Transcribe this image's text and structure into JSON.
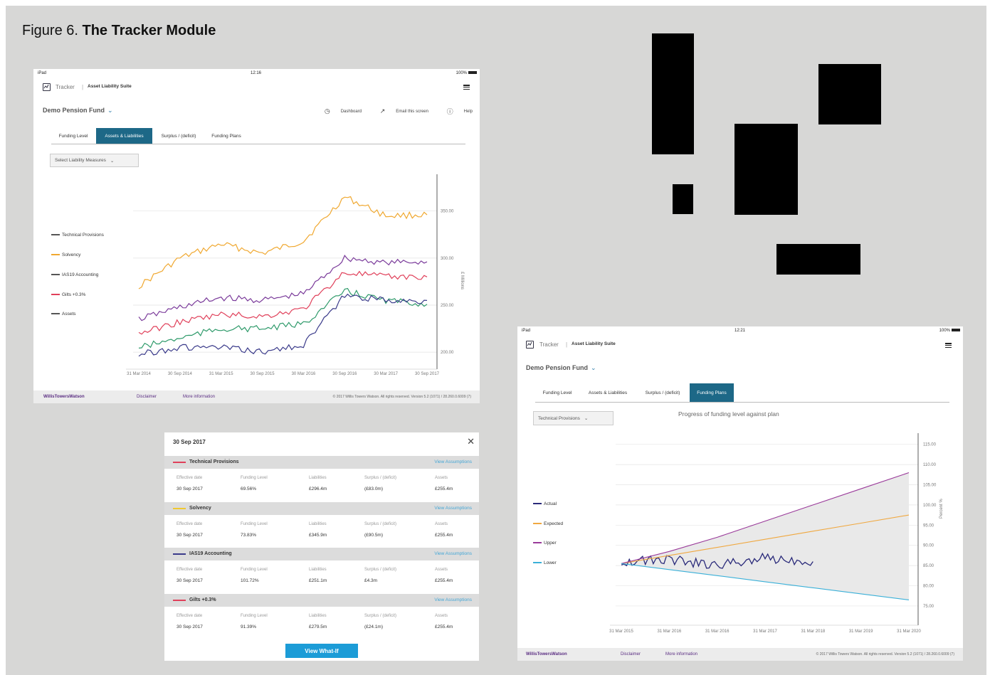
{
  "figure": {
    "label": "Figure 6.",
    "title": "The Tracker Module"
  },
  "screen1": {
    "status": {
      "carrier": "iPad",
      "time": "12:16",
      "battery": "100%"
    },
    "app": {
      "name": "Tracker",
      "suite": "Asset Liability Suite"
    },
    "fund": "Demo Pension Fund",
    "actions": {
      "dashboard": "Dashboard",
      "email": "Email this screen",
      "help": "Help"
    },
    "tabs": [
      "Funding Level",
      "Assets & Liabilities",
      "Surplus / (deficit)",
      "Funding Plans"
    ],
    "active_tab": "Assets & Liabilities",
    "select": "Select Liability Measures",
    "legend": [
      "Technical Provisions",
      "Solvency",
      "IAS19 Accounting",
      "Gilts +0.3%",
      "Assets"
    ],
    "colors": {
      "technical_provisions": "#7a3a9a",
      "solvency": "#f0a830",
      "ias19": "#2e9a6a",
      "gilts": "#e0405a",
      "assets": "#3a3a8a"
    },
    "y_axis_label": "£ Millions",
    "y_ticks": [
      "350.00",
      "300.00",
      "250.00",
      "200.00"
    ],
    "x_ticks": [
      "31 Mar 2014",
      "30 Sep 2014",
      "31 Mar 2015",
      "30 Sep 2015",
      "30 Mar 2016",
      "30 Sep 2016",
      "30 Mar 2017",
      "30 Sep 2017"
    ],
    "footer": {
      "brand": "WillisTowersWatson",
      "disclaimer": "Disclaimer",
      "more": "More information",
      "copyright": "© 2017 Willis Towers Watson. All rights reserved. Version 5.2 (1071) / 28.260.0.6009 (7)"
    }
  },
  "popup": {
    "date": "30 Sep 2017",
    "view_assumptions": "View Assumptions",
    "headers": [
      "Effective date",
      "Funding Level",
      "Liabilities",
      "Surplus / (deficit)",
      "Assets"
    ],
    "sections": [
      {
        "name": "Technical Provisions",
        "color": "#e0405a",
        "values": [
          "30 Sep 2017",
          "69.56%",
          "£296.4m",
          "(£83.0m)",
          "£255.4m"
        ]
      },
      {
        "name": "Solvency",
        "color": "#f0c830",
        "values": [
          "30 Sep 2017",
          "73.83%",
          "£345.9m",
          "(£90.5m)",
          "£255.4m"
        ]
      },
      {
        "name": "IAS19 Accounting",
        "color": "#3a3a8a",
        "values": [
          "30 Sep 2017",
          "101.72%",
          "£251.1m",
          "£4.3m",
          "£255.4m"
        ]
      },
      {
        "name": "Gilts +0.3%",
        "color": "#e0405a",
        "values": [
          "30 Sep 2017",
          "91.39%",
          "£279.5m",
          "(£24.1m)",
          "£255.4m"
        ]
      }
    ],
    "button": "View What-If"
  },
  "screen2": {
    "status": {
      "carrier": "iPad",
      "time": "12:21",
      "battery": "100%"
    },
    "app": {
      "name": "Tracker",
      "suite": "Asset Liability Suite"
    },
    "fund": "Demo Pension Fund",
    "tabs": [
      "Funding Level",
      "Assets & Liabilities",
      "Surplus / (deficit)",
      "Funding Plans"
    ],
    "active_tab": "Funding Plans",
    "select": "Technical Provisions",
    "chart_title": "Progress of funding level against plan",
    "legend": [
      "Actual",
      "Expected",
      "Upper",
      "Lower"
    ],
    "colors": {
      "actual": "#2a2a7a",
      "expected": "#f0a840",
      "upper": "#9a3a9a",
      "lower": "#3ab0d8"
    },
    "y_axis_label": "Percent %",
    "y_ticks": [
      "115.00",
      "110.00",
      "105.00",
      "100.00",
      "95.00",
      "90.00",
      "85.00",
      "80.00",
      "75.00"
    ],
    "x_ticks": [
      "31 Mar 2015",
      "31 Mar 2016",
      "31 Mar 2016",
      "31 Mar 2017",
      "31 Mar 2018",
      "31 Mar 2019",
      "31 Mar 2020"
    ],
    "footer": {
      "brand": "WillisTowersWatson",
      "disclaimer": "Disclaimer",
      "more": "More information",
      "copyright": "© 2017 Willis Towers Watson. All rights reserved. Version 5.2 (1071) / 28.260.0.6009 (7)"
    }
  },
  "chart_data": [
    {
      "type": "line",
      "x": [
        "31 Mar 2014",
        "30 Sep 2014",
        "31 Mar 2015",
        "30 Sep 2015",
        "30 Mar 2016",
        "30 Sep 2016",
        "30 Mar 2017",
        "30 Sep 2017"
      ],
      "ylabel": "£ Millions",
      "ylim": [
        185,
        380
      ],
      "series": [
        {
          "name": "Solvency",
          "values": [
            270,
            300,
            315,
            305,
            318,
            365,
            345,
            346
          ]
        },
        {
          "name": "Technical Provisions",
          "values": [
            235,
            248,
            258,
            255,
            262,
            300,
            295,
            296
          ]
        },
        {
          "name": "Gilts +0.3%",
          "values": [
            220,
            232,
            240,
            238,
            246,
            285,
            280,
            280
          ]
        },
        {
          "name": "IAS19 Accounting",
          "values": [
            205,
            215,
            225,
            225,
            230,
            265,
            255,
            251
          ]
        },
        {
          "name": "Assets",
          "values": [
            198,
            205,
            205,
            200,
            208,
            260,
            255,
            255
          ]
        }
      ]
    },
    {
      "type": "line",
      "title": "Progress of funding level against plan",
      "x": [
        "31 Mar 2015",
        "31 Mar 2016",
        "31 Mar 2016",
        "31 Mar 2017",
        "31 Mar 2018",
        "31 Mar 2019",
        "31 Mar 2020"
      ],
      "ylabel": "Percent %",
      "ylim": [
        72,
        116
      ],
      "series": [
        {
          "name": "Actual",
          "values": [
            86,
            86.5,
            85,
            87,
            86
          ]
        },
        {
          "name": "Expected",
          "values": [
            85.5,
            87.5,
            89.5,
            91.5,
            93.5,
            95.5,
            97.5
          ]
        },
        {
          "name": "Upper",
          "values": [
            85.5,
            88.5,
            92,
            96,
            100,
            104,
            108
          ]
        },
        {
          "name": "Lower",
          "values": [
            85.5,
            84,
            82.5,
            81,
            79.5,
            78,
            76.5
          ]
        }
      ]
    }
  ]
}
